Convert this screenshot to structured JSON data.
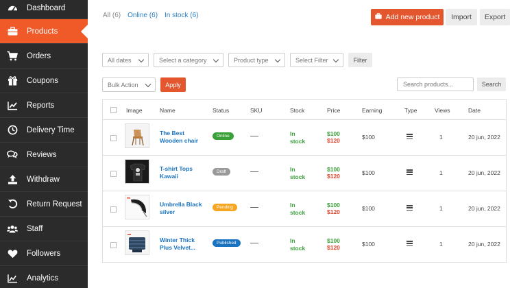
{
  "sidebar": {
    "items": [
      {
        "label": "Dashboard",
        "icon": "dashboard-icon"
      },
      {
        "label": "Products",
        "icon": "briefcase-icon",
        "active": true
      },
      {
        "label": "Orders",
        "icon": "cart-icon"
      },
      {
        "label": "Coupons",
        "icon": "gift-icon"
      },
      {
        "label": "Reports",
        "icon": "chart-icon"
      },
      {
        "label": "Delivery Time",
        "icon": "clock-icon"
      },
      {
        "label": "Reviews",
        "icon": "comments-icon"
      },
      {
        "label": "Withdraw",
        "icon": "upload-icon"
      },
      {
        "label": "Return Request",
        "icon": "undo-icon"
      },
      {
        "label": "Staff",
        "icon": "users-icon"
      },
      {
        "label": "Followers",
        "icon": "heart-icon"
      },
      {
        "label": "Analytics",
        "icon": "analytics-icon"
      }
    ]
  },
  "filters_links": {
    "all": "All (6)",
    "online": "Online (6)",
    "in_stock": "In stock (6)"
  },
  "actions": {
    "add_new": "Add new product",
    "import": "Import",
    "export": "Export"
  },
  "filters": {
    "dates": "All dates",
    "category": "Select a category",
    "product_type": "Product type",
    "select_filter": "Select Filter",
    "filter_button": "Filter"
  },
  "bulk": {
    "action": "Bulk Action",
    "apply": "Apply"
  },
  "search": {
    "placeholder": "Search products...",
    "button": "Search"
  },
  "table": {
    "headers": [
      "Image",
      "Name",
      "Status",
      "SKU",
      "Stock",
      "Price",
      "Earning",
      "Type",
      "Views",
      "Date"
    ],
    "rows": [
      {
        "name": "The Best Wooden chair",
        "status": "Online",
        "status_color": "#3aa03a",
        "sku": "—",
        "stock": "In stock",
        "price_regular": "$100",
        "price_sale": "$120",
        "earning": "$100",
        "type_icon": "menu-icon",
        "views": "1",
        "date": "20 jun, 2022",
        "image": "chair"
      },
      {
        "name": "T-shirt Tops Kawaii",
        "status": "Draft",
        "status_color": "#999999",
        "sku": "—",
        "stock": "In stock",
        "price_regular": "$100",
        "price_sale": "$120",
        "earning": "$100",
        "type_icon": "menu-icon",
        "views": "1",
        "date": "20 jun, 2022",
        "image": "tshirt"
      },
      {
        "name": "Umbrella Black silver",
        "status": "Pending",
        "status_color": "#f5a623",
        "sku": "—",
        "stock": "In stock",
        "price_regular": "$100",
        "price_sale": "$120",
        "earning": "$100",
        "type_icon": "menu-icon",
        "views": "1",
        "date": "20 jun, 2022",
        "image": "umbrella"
      },
      {
        "name": "Winter Thick Plus Velvet...",
        "status": "Published",
        "status_color": "#1a73c0",
        "sku": "—",
        "stock": "In stock",
        "price_regular": "$100",
        "price_sale": "$120",
        "earning": "$100",
        "type_icon": "menu-icon",
        "views": "1",
        "date": "20 jun, 2022",
        "image": "jacket"
      }
    ]
  }
}
